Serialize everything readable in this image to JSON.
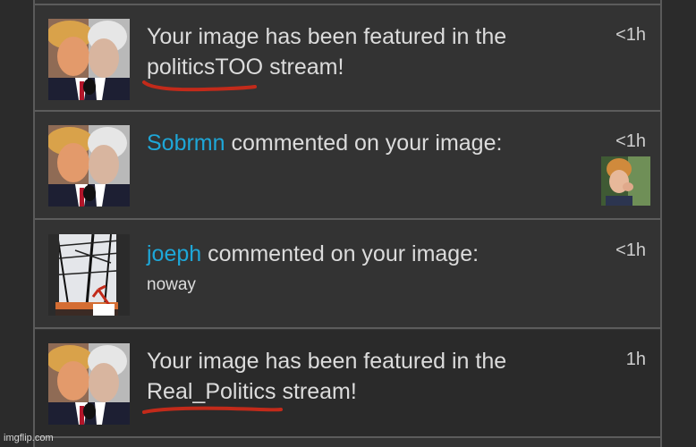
{
  "notifications": [
    {
      "thumbnail": "trump-biden-kiss-meme",
      "text_line1": "Your image has been featured in the",
      "stream": "politicsTOO",
      "stream_suffix": " stream!",
      "time": "<1h"
    },
    {
      "thumbnail": "trump-biden-kiss-meme",
      "username": "Sobrmn",
      "action": " commented on your image:",
      "reply_thumbnail": "woman-blowing-kiss-reaction",
      "time": "<1h"
    },
    {
      "thumbnail": "power-lines-with-red-arrow",
      "username": "joeph",
      "action": " commented on your image:",
      "comment": "noway",
      "time": "<1h"
    },
    {
      "thumbnail": "trump-biden-kiss-meme",
      "text_line1": "Your image has been featured in the",
      "stream": "Real_Politics",
      "stream_suffix": " stream!",
      "time": "1h"
    }
  ],
  "annotations": {
    "underline_color": "#c22a1a"
  },
  "colors": {
    "username": "#1ea7d8",
    "text": "#dcdcdc",
    "background": "#333333"
  },
  "watermark": "imgflip.com"
}
